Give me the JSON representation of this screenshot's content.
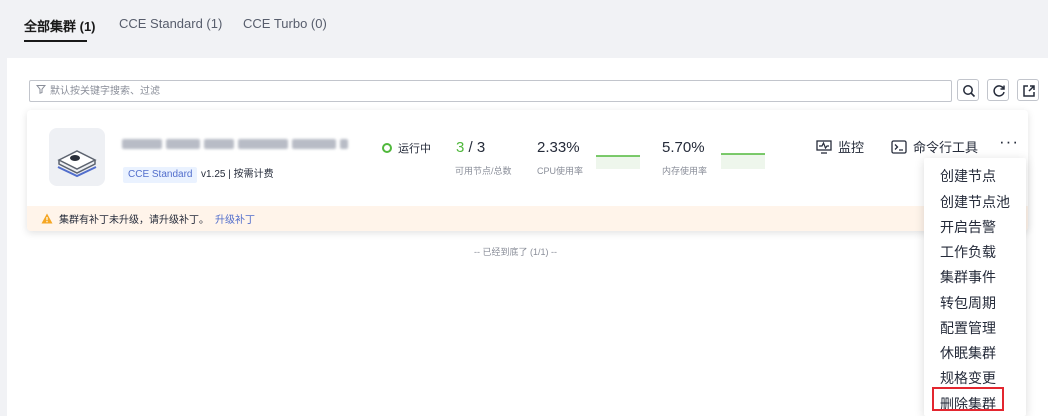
{
  "tabs": [
    {
      "label": "全部集群 (1)",
      "active": true
    },
    {
      "label": "CCE Standard (1)",
      "active": false
    },
    {
      "label": "CCE Turbo (0)",
      "active": false
    }
  ],
  "search": {
    "placeholder": "默认按关键字搜索、过滤",
    "filter_icon": "filter-icon",
    "tools": [
      "search-icon",
      "refresh-icon",
      "export-icon"
    ]
  },
  "cluster": {
    "icon": "cluster-icon",
    "type_badge": "CCE Standard",
    "meta": "v1.25 | 按需计费",
    "status": "运行中",
    "status_color": "#50b83c",
    "nodes": {
      "available": "3",
      "sep": " / ",
      "total": "3",
      "label": "可用节点/总数"
    },
    "cpu": {
      "value": "2.33%",
      "label": "CPU使用率"
    },
    "memory": {
      "value": "5.70%",
      "label": "内存使用率"
    },
    "actions": {
      "monitor": "监控",
      "kubectl": "命令行工具",
      "more": "···"
    },
    "alert": {
      "text": "集群有补丁未升级，请升级补丁。",
      "link": "升级补丁",
      "icon": "warning-icon"
    }
  },
  "footer_note": "-- 已经到底了 (1/1) --",
  "more_menu": [
    "创建节点",
    "创建节点池",
    "开启告警",
    "工作负载",
    "集群事件",
    "转包周期",
    "配置管理",
    "休眠集群",
    "规格变更",
    "删除集群"
  ],
  "highlighted_menu_item": "规格变更",
  "colors": {
    "accent": "#526ecc",
    "success": "#50b83c",
    "warning": "#f5a623",
    "highlight": "#e3262f"
  }
}
